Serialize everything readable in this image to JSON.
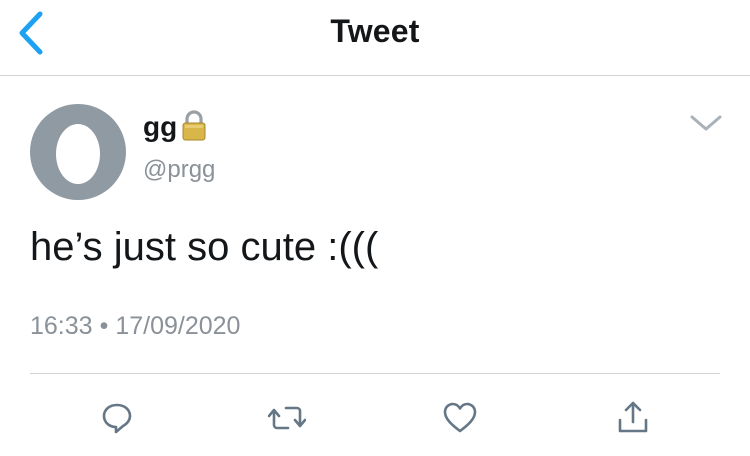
{
  "header": {
    "title": "Tweet",
    "back_icon": "chevron-left-icon",
    "accent_color": "#1da1f2"
  },
  "tweet": {
    "author": {
      "display_name": "gg",
      "handle": "@prgg",
      "protected_icon": "lock-icon",
      "avatar": "default-egg-avatar"
    },
    "more_icon": "chevron-down-icon",
    "text": "he’s just so cute :(((",
    "time": "16:33",
    "separator": "•",
    "date": "17/09/2020"
  },
  "actions": [
    {
      "name": "reply",
      "icon": "reply-icon"
    },
    {
      "name": "retweet",
      "icon": "retweet-icon"
    },
    {
      "name": "like",
      "icon": "heart-icon"
    },
    {
      "name": "share",
      "icon": "share-icon"
    }
  ],
  "colors": {
    "text": "#14171a",
    "secondary_text": "#8a9198",
    "icon_gray": "#657786",
    "divider": "#cfd4d8",
    "avatar_bg": "#8f9aa3"
  }
}
